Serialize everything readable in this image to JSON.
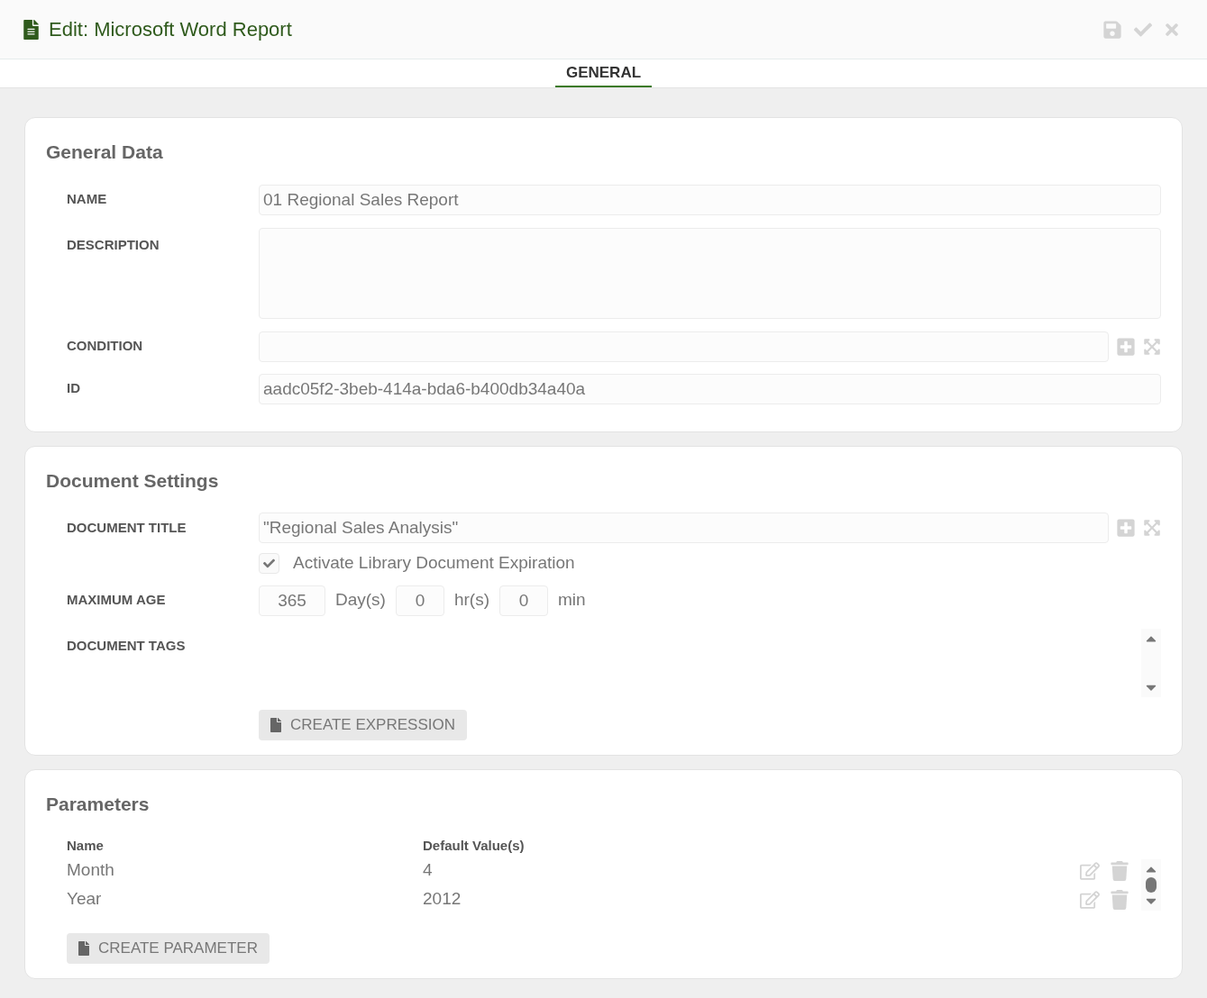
{
  "window": {
    "title": "Edit: Microsoft Word Report"
  },
  "tabs": [
    {
      "label": "GENERAL",
      "selected": true
    }
  ],
  "general_data": {
    "title": "General Data",
    "fields": [
      {
        "kind": "text",
        "label": "NAME",
        "value": "01 Regional Sales Report"
      },
      {
        "kind": "textarea",
        "label": "DESCRIPTION"
      },
      {
        "kind": "expression",
        "label": "CONDITION"
      },
      {
        "kind": "text",
        "label": "ID",
        "value": "aadc05f2-3beb-414a-bda6-b400db34a40a"
      }
    ]
  },
  "document_settings": {
    "title": "Document Settings",
    "document_title": {
      "label": "DOCUMENT TITLE",
      "value": "\"Regional Sales Analysis\""
    },
    "expiration": {
      "label": "Activate Library Document Expiration",
      "checked": true
    },
    "maximum_age": {
      "label": "MAXIMUM AGE",
      "parts": [
        {
          "value": "365",
          "unit": "Day(s)"
        },
        {
          "value": "0",
          "unit": "hr(s)"
        },
        {
          "value": "0",
          "unit": "min"
        }
      ]
    },
    "document_tags": {
      "label": "DOCUMENT TAGS"
    },
    "create_button": "CREATE EXPRESSION"
  },
  "parameters": {
    "title": "Parameters",
    "columns": [
      "Name",
      "Default Value(s)"
    ],
    "rows": [
      {
        "name": "Month",
        "default": "4"
      },
      {
        "name": "Year",
        "default": "2012"
      }
    ],
    "create_button": "CREATE PARAMETER"
  }
}
